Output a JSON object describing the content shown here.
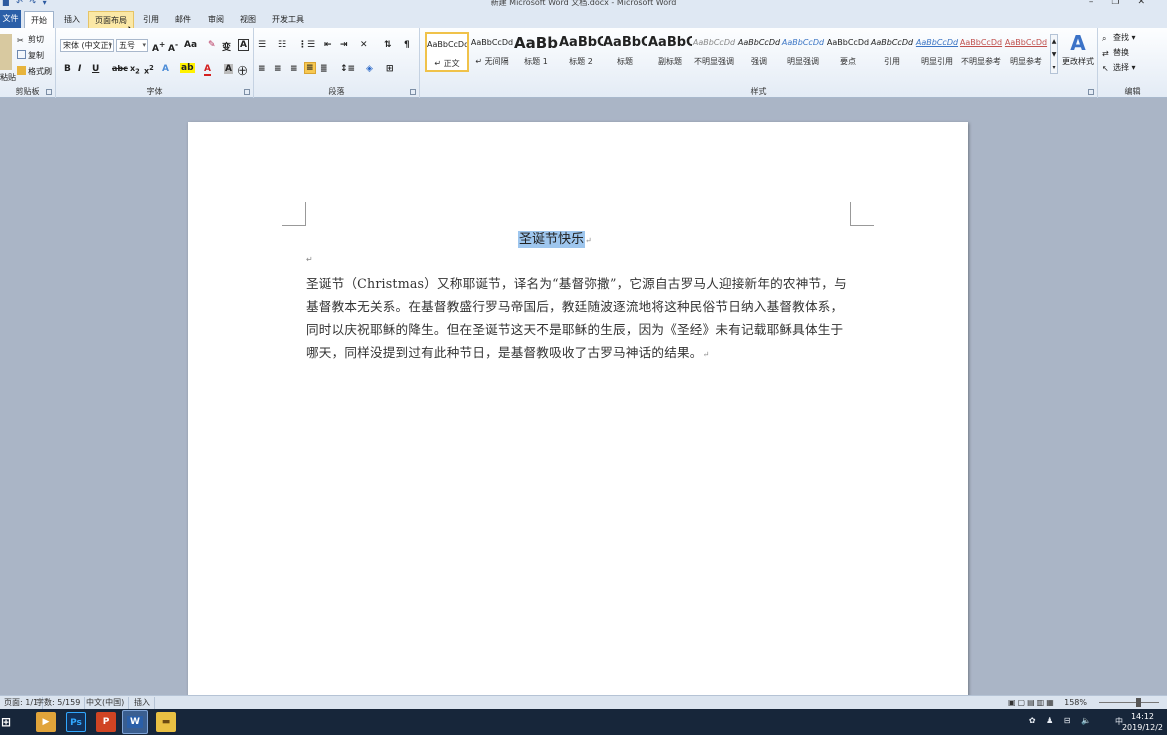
{
  "window": {
    "title": "新建 Microsoft Word 文档.docx - Microsoft Word",
    "min_glyph": "–",
    "max_glyph": "❐",
    "close_glyph": "✕"
  },
  "tabs": [
    {
      "label": "文件"
    },
    {
      "label": "开始"
    },
    {
      "label": "插入"
    },
    {
      "label": "页面布局"
    },
    {
      "label": "引用"
    },
    {
      "label": "邮件"
    },
    {
      "label": "审阅"
    },
    {
      "label": "视图"
    },
    {
      "label": "开发工具"
    }
  ],
  "ribbon": {
    "clipboard": {
      "paste": "粘贴",
      "cut": "剪切",
      "copy": "复制",
      "format_painter": "格式刷",
      "label": "剪贴板"
    },
    "font": {
      "font_name": "宋体 (中文正)",
      "font_size": "五号",
      "label": "字体"
    },
    "paragraph": {
      "label": "段落"
    },
    "styles": {
      "items": [
        {
          "sample": "AaBbCcDd",
          "name": "↵ 正文"
        },
        {
          "sample": "AaBbCcDd",
          "name": "↵ 无间隔"
        },
        {
          "sample": "AaBb",
          "name": "标题 1"
        },
        {
          "sample": "AaBbC",
          "name": "标题 2"
        },
        {
          "sample": "AaBbC",
          "name": "标题"
        },
        {
          "sample": "AaBbC",
          "name": "副标题"
        },
        {
          "sample": "AaBbCcDd",
          "name": "不明显强调"
        },
        {
          "sample": "AaBbCcDd",
          "name": "强调"
        },
        {
          "sample": "AaBbCcDd",
          "name": "明显强调"
        },
        {
          "sample": "AaBbCcDd",
          "name": "要点"
        },
        {
          "sample": "AaBbCcDd",
          "name": "引用"
        },
        {
          "sample": "AaBbCcDd",
          "name": "明显引用"
        },
        {
          "sample": "AaBbCcDd",
          "name": "不明显参考"
        },
        {
          "sample": "AaBbCcDd",
          "name": "明显参考"
        }
      ],
      "change_styles": "更改样式",
      "label": "样式"
    },
    "editing": {
      "find": "查找",
      "replace": "替换",
      "select": "选择",
      "label": "编辑"
    }
  },
  "document": {
    "title": "圣诞节快乐",
    "paragraph_mark": "↵",
    "body": "圣诞节（Christmas）又称耶诞节，译名为“基督弥撒”，它源自古罗马人迎接新年的农神节，与基督教本无关系。在基督教盛行罗马帝国后，教廷随波逐流地将这种民俗节日纳入基督教体系，同时以庆祝耶稣的降生。但在圣诞节这天不是耶稣的生辰，因为《圣经》未有记载耶稣具体生于哪天，同样没提到过有此种节日，是基督教吸收了古罗马神话的结果。"
  },
  "status": {
    "page": "页面: 1/1",
    "words": "字数: 5/159",
    "language": "中文(中国)",
    "insert": "插入",
    "zoom": "158%"
  },
  "taskbar": {
    "ime": "中",
    "time": "14:12",
    "date": "2019/12/2"
  }
}
